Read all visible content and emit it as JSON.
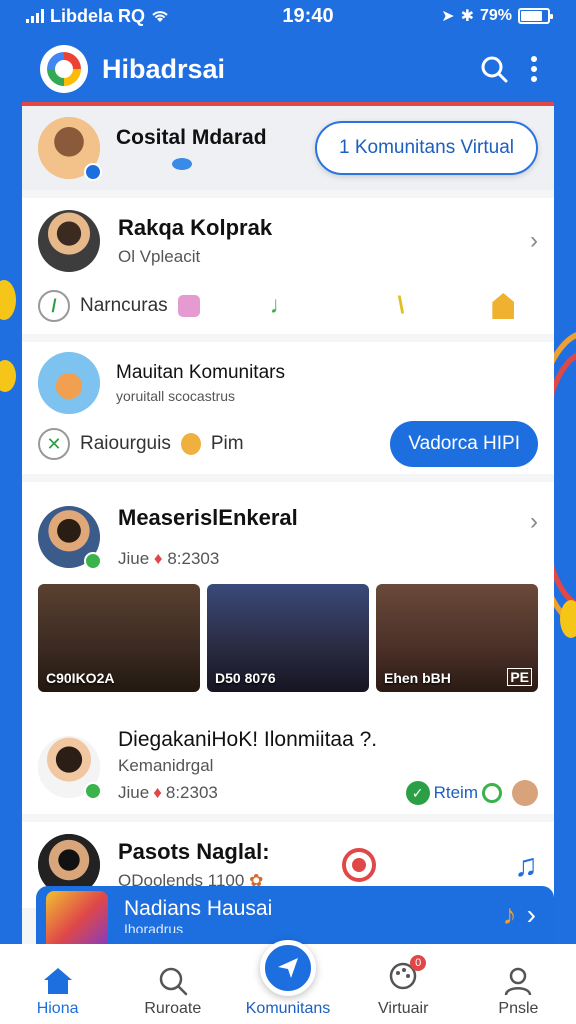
{
  "status": {
    "carrier": "Libdela RQ",
    "time": "19:40",
    "battery": "79%",
    "battery_level": 0.79
  },
  "app": {
    "title": "Hibadrsai",
    "search_icon": "search-icon",
    "menu_icon": "more-vertical-icon"
  },
  "top_card": {
    "name": "Cosital Mdarad",
    "button": "1 Komunitans Virtual"
  },
  "profile_card": {
    "name": "Rakqa Kolprak",
    "sub": "Ol Vpleacit",
    "action": "Narncuras"
  },
  "community_card": {
    "title": "Mauitan Komunitars",
    "sub": "yoruitall scocastrus",
    "action_1": "Raiourguis",
    "action_2": "Pim",
    "button": "Vadorca HIPI"
  },
  "event_card": {
    "name": "MeaserislEnkeral",
    "sub": "Jiue",
    "time": "8:2303",
    "photos": [
      {
        "caption": "C90IKO2A"
      },
      {
        "caption": "D50 8076"
      },
      {
        "caption": "Ehen bBH"
      }
    ],
    "photo_badge": "PE"
  },
  "post_card": {
    "name": "DiegakaniHoK! Ilonmiitaa ?.",
    "sub": "Kemanidrgal",
    "meta": "Jiue",
    "time": "8:2303",
    "tag": "Rteim"
  },
  "music_card": {
    "name": "Pasots Naglal:",
    "sub": "ODoolends 1100"
  },
  "banner": {
    "title": "Nadians Hausai",
    "sub": "Ihoradrus"
  },
  "nav": [
    {
      "label": "Hiona",
      "icon": "home-icon"
    },
    {
      "label": "Ruroate",
      "icon": "search-icon"
    },
    {
      "label": "Komunitans",
      "icon": "send-icon"
    },
    {
      "label": "Virtuair",
      "icon": "palette-icon"
    },
    {
      "label": "Pnsle",
      "icon": "person-icon"
    }
  ],
  "nav_badge": "0",
  "colors": {
    "primary": "#1d6fe0",
    "accent_red": "#e04848",
    "green": "#2b9f45"
  }
}
